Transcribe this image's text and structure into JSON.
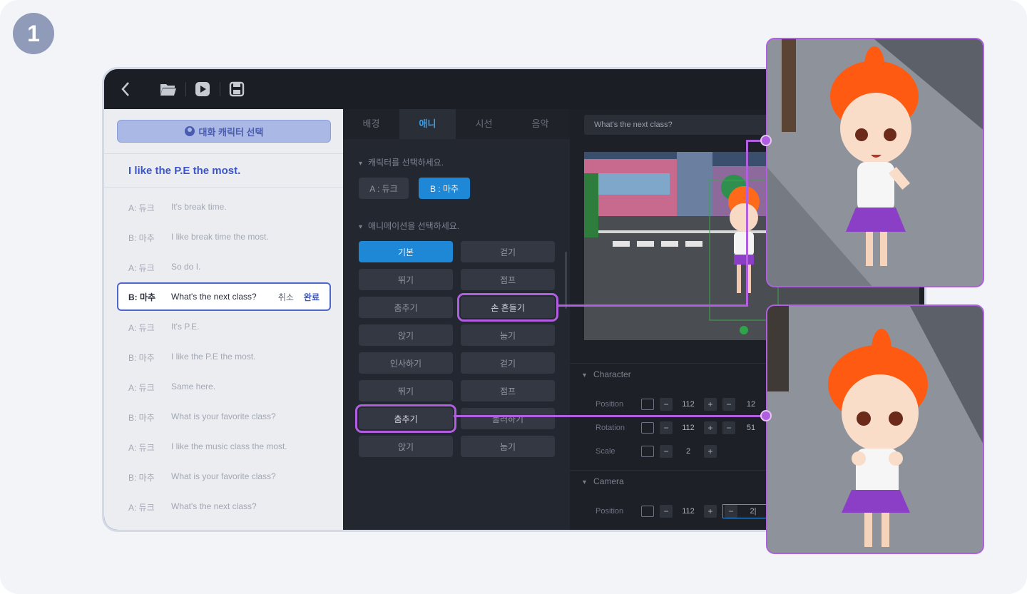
{
  "step_number": "1",
  "toolbar": {
    "back_icon": "chevron-left-icon",
    "open_icon": "folder-icon",
    "play_icon": "play-icon",
    "save_icon": "save-icon"
  },
  "dialog_panel": {
    "select_character_button": "대화 캐릭터 선택",
    "title": "I like the P.E the most.",
    "lines": [
      {
        "speaker": "A: 듀크",
        "text": "It's break time."
      },
      {
        "speaker": "B: 마추",
        "text": "I like break time the most."
      },
      {
        "speaker": "A: 듀크",
        "text": "So do I."
      },
      {
        "speaker": "B: 마추",
        "text": "What's the next class?",
        "editing": true
      },
      {
        "speaker": "A: 듀크",
        "text": "It's P.E."
      },
      {
        "speaker": "B: 마추",
        "text": "I like the P.E the most."
      },
      {
        "speaker": "A: 듀크",
        "text": "Same here."
      },
      {
        "speaker": "B: 마추",
        "text": "What is your favorite class?"
      },
      {
        "speaker": "A: 듀크",
        "text": "I like the music class the most."
      },
      {
        "speaker": "B: 마추",
        "text": "What is your favorite class?"
      },
      {
        "speaker": "A: 듀크",
        "text": "What's the next class?"
      }
    ],
    "edit_cancel": "취소",
    "edit_done": "완료"
  },
  "anim_panel": {
    "tabs": [
      "배경",
      "애니",
      "시선",
      "음악"
    ],
    "active_tab": "애니",
    "choose_character_label": "캐릭터를 선택하세요.",
    "character_a": "A : 듀크",
    "character_b": "B : 마추",
    "choose_animation_label": "애니메이션을 선택하세요.",
    "animations": [
      [
        "기본",
        "걷기"
      ],
      [
        "뛰기",
        "점프"
      ],
      [
        "춤추기",
        "손 흔들기"
      ],
      [
        "앉기",
        "눕기"
      ],
      [
        "인사하기",
        "걷기"
      ],
      [
        "뛰기",
        "점프"
      ],
      [
        "춤추기",
        "둘러하기"
      ],
      [
        "앉기",
        "눕기"
      ]
    ],
    "active_animation": "기본"
  },
  "scene_panel": {
    "line_text": "What's the next class?",
    "character_section": "Character",
    "camera_section": "Camera",
    "props": {
      "position_label": "Position",
      "rotation_label": "Rotation",
      "scale_label": "Scale",
      "char_position": [
        "112",
        "12"
      ],
      "char_rotation": [
        "112",
        "51"
      ],
      "char_scale": "2",
      "cam_position": [
        "112",
        "2|"
      ]
    }
  },
  "colors": {
    "highlight": "#b15fe0",
    "accent_blue": "#1e88d6",
    "dialog_blue": "#3c56c9"
  }
}
